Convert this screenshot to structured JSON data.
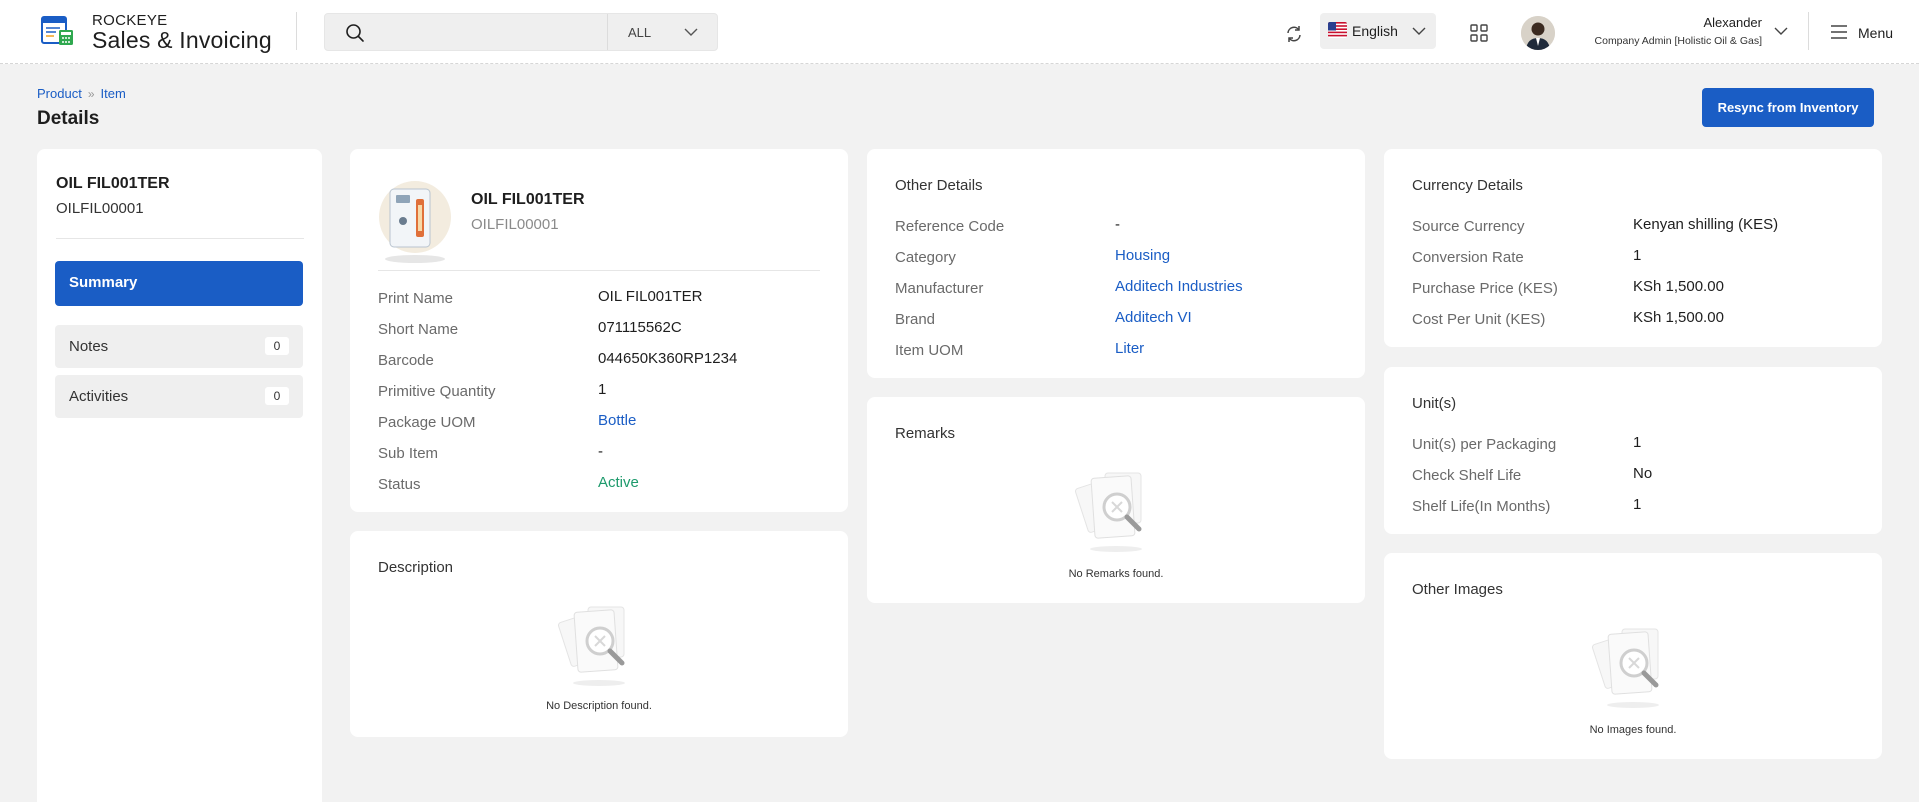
{
  "app": {
    "brand_top": "ROCKEYE",
    "brand_main": "Sales & Invoicing"
  },
  "header": {
    "search_placeholder": "",
    "search_filter": "ALL",
    "language": "English",
    "user_name": "Alexander",
    "user_role": "Company Admin [Holistic Oil & Gas]",
    "menu_label": "Menu"
  },
  "breadcrumb": {
    "items": [
      "Product",
      "Item"
    ]
  },
  "page": {
    "title": "Details",
    "resync_label": "Resync from Inventory"
  },
  "sidebar": {
    "item_name": "OIL FIL001TER",
    "item_code": "OILFIL00001",
    "nav": [
      {
        "label": "Summary"
      },
      {
        "label": "Notes",
        "count": "0"
      },
      {
        "label": "Activities",
        "count": "0"
      }
    ]
  },
  "item": {
    "name": "OIL FIL001TER",
    "code": "OILFIL00001",
    "rows": [
      {
        "label": "Print Name",
        "value": "OIL FIL001TER"
      },
      {
        "label": "Short Name",
        "value": "071115562C"
      },
      {
        "label": "Barcode",
        "value": "044650K360RP1234"
      },
      {
        "label": "Primitive Quantity",
        "value": "1"
      },
      {
        "label": "Package UOM",
        "value": "Bottle"
      },
      {
        "label": "Sub Item",
        "value": "-"
      },
      {
        "label": "Status",
        "value": "Active"
      }
    ]
  },
  "description": {
    "title": "Description",
    "empty": "No Description found."
  },
  "other_details": {
    "title": "Other Details",
    "rows": [
      {
        "label": "Reference Code",
        "value": "-"
      },
      {
        "label": "Category",
        "value": "Housing"
      },
      {
        "label": "Manufacturer",
        "value": "Additech Industries"
      },
      {
        "label": "Brand",
        "value": "Additech VI"
      },
      {
        "label": "Item UOM",
        "value": "Liter"
      }
    ]
  },
  "remarks": {
    "title": "Remarks",
    "empty": "No Remarks found."
  },
  "currency": {
    "title": "Currency Details",
    "rows": [
      {
        "label": "Source Currency",
        "value": "Kenyan shilling (KES)"
      },
      {
        "label": "Conversion Rate",
        "value": "1"
      },
      {
        "label": "Purchase Price (KES)",
        "value": "KSh 1,500.00"
      },
      {
        "label": "Cost Per Unit (KES)",
        "value": "KSh 1,500.00"
      }
    ]
  },
  "units": {
    "title": "Unit(s)",
    "rows": [
      {
        "label": "Unit(s) per Packaging",
        "value": "1"
      },
      {
        "label": "Check Shelf Life",
        "value": "No"
      },
      {
        "label": "Shelf Life(In Months)",
        "value": "1"
      }
    ]
  },
  "other_images": {
    "title": "Other Images",
    "empty": "No Images found."
  },
  "colors": {
    "primary": "#1a5dc5",
    "status_active": "#1d9a6c"
  }
}
